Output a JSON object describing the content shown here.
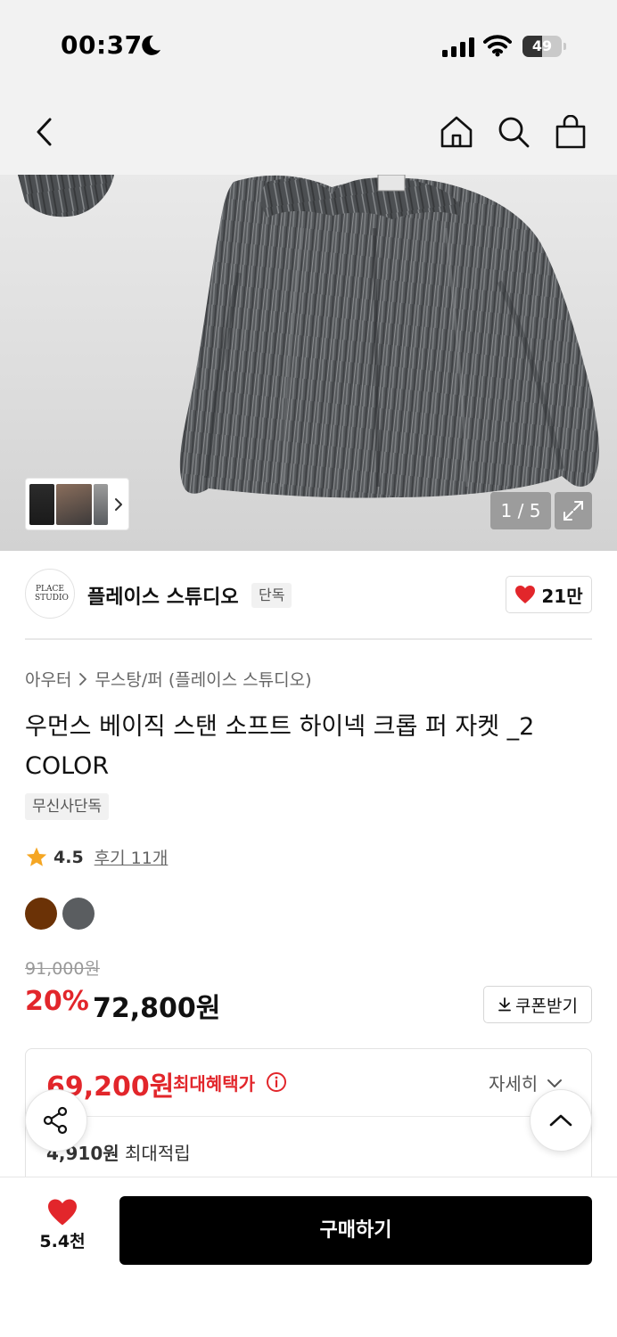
{
  "status_bar": {
    "time": "00:37",
    "battery_level": "49",
    "battery_fraction": 0.49,
    "icons": [
      "moon-icon",
      "signal-icon",
      "wifi-icon",
      "battery-icon"
    ]
  },
  "nav": {
    "icons": [
      "back-chevron-icon",
      "home-icon",
      "search-icon",
      "shopping-bag-icon"
    ]
  },
  "gallery": {
    "pager_text": "1 / 5",
    "icons": [
      "thumbnail-next-icon",
      "expand-icon"
    ]
  },
  "brand": {
    "name": "플레이스 스튜디오",
    "badge": "단독",
    "logo_text": "PLACE STUDIO",
    "like_count": "21만",
    "like_icon": "heart-icon"
  },
  "breadcrumb": {
    "items": [
      "아우터",
      "무스탕/퍼 (플레이스 스튜디오)"
    ]
  },
  "product": {
    "title": "우먼스 베이직 스탠 소프트 하이넥 크롭 퍼 자켓 _2 COLOR",
    "tag": "무신사단독",
    "rating": "4.5",
    "review_link": "후기 11개",
    "colors": [
      {
        "name": "brown",
        "hex": "#6b3206"
      },
      {
        "name": "gray",
        "hex": "#5a5d60"
      }
    ]
  },
  "price": {
    "original": "91,000원",
    "discount_rate": "20%",
    "sale": "72,800원",
    "coupon_button": "쿠폰받기"
  },
  "benefit": {
    "max_price": "69,200원",
    "max_label": "최대혜택가",
    "detail_toggle": "자세히",
    "points_amount": "4,910원",
    "points_label": "최대적립"
  },
  "bottom_bar": {
    "wish_count": "5.4천",
    "buy_button": "구매하기"
  },
  "colors": {
    "accent_red": "#e2262b",
    "buy_button": "#000000",
    "nav_background": "#f2f2f2"
  }
}
